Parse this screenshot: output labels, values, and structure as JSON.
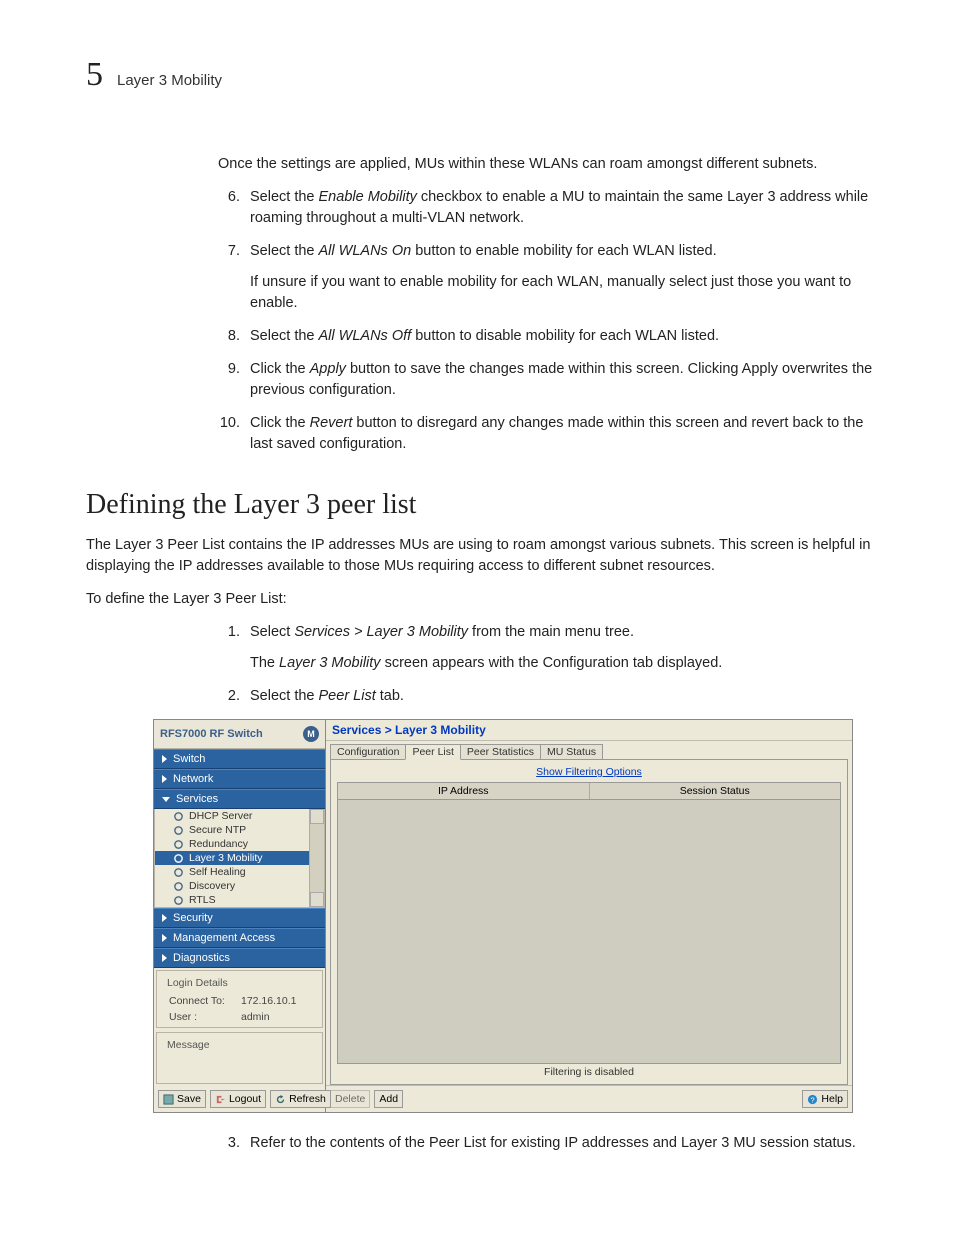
{
  "header": {
    "chapter": "5",
    "title": "Layer 3 Mobility"
  },
  "intro": "Once the settings are applied, MUs within these WLANs can roam amongst different subnets.",
  "steps_a": [
    {
      "n": "6.",
      "text": "Select the Enable Mobility checkbox to enable a MU to maintain the same Layer 3 address while roaming throughout a multi-VLAN network.",
      "italic": "Enable Mobility"
    },
    {
      "n": "7.",
      "text": "Select the All WLANs On button to enable mobility for each WLAN listed.",
      "italic": "All WLANs On",
      "sub": "If unsure if you want to enable mobility for each WLAN, manually select just those you want to enable."
    },
    {
      "n": "8.",
      "text": "Select the All WLANs Off button to disable mobility for each WLAN listed.",
      "italic": "All WLANs Off"
    },
    {
      "n": "9.",
      "text": "Click the Apply button to save the changes made within this screen. Clicking Apply overwrites the previous configuration.",
      "italic": "Apply"
    },
    {
      "n": "10.",
      "text": "Click the Revert button to disregard any changes made within this screen and revert back to the last saved configuration.",
      "italic": "Revert"
    }
  ],
  "section_title": "Defining the Layer 3 peer list",
  "section_p1": "The Layer 3 Peer List contains the IP addresses MUs are using to roam amongst various subnets. This screen is helpful in displaying the IP addresses available to those MUs requiring access to different subnet resources.",
  "section_p2": "To define the Layer 3 Peer List:",
  "steps_b": [
    {
      "n": "1.",
      "text": "Select Services > Layer 3 Mobility from the main menu tree.",
      "italic": "Services > Layer 3 Mobility",
      "sub": "The Layer 3 Mobility screen appears with the Configuration tab displayed.",
      "sub_italic": "Layer 3 Mobility"
    },
    {
      "n": "2.",
      "text": "Select the Peer List tab.",
      "italic": "Peer List"
    }
  ],
  "step_after": {
    "n": "3.",
    "text": "Refer to the contents of the Peer List for existing IP addresses and Layer 3 MU session status."
  },
  "screenshot": {
    "brand_label": "RFS7000 RF Switch",
    "brand_bold": "7000",
    "nav": {
      "switch": "Switch",
      "network": "Network",
      "services": "Services",
      "items": [
        "DHCP Server",
        "Secure NTP",
        "Redundancy",
        "Layer 3 Mobility",
        "Self Healing",
        "Discovery",
        "RTLS"
      ],
      "selected_index": 3,
      "security": "Security",
      "mgmt": "Management Access",
      "diag": "Diagnostics"
    },
    "login_panel": {
      "title": "Login Details",
      "connect_lbl": "Connect To:",
      "connect_val": "172.16.10.1",
      "user_lbl": "User :",
      "user_val": "admin"
    },
    "message_panel": {
      "title": "Message"
    },
    "side_buttons": {
      "save": "Save",
      "logout": "Logout",
      "refresh": "Refresh"
    },
    "crumb": "Services > Layer 3 Mobility",
    "tabs": [
      "Configuration",
      "Peer List",
      "Peer Statistics",
      "MU Status"
    ],
    "active_tab": 1,
    "filter_link": "Show Filtering Options",
    "columns": [
      "IP Address",
      "Session Status"
    ],
    "filter_note": "Filtering is disabled",
    "footer": {
      "delete": "Delete",
      "add": "Add",
      "help": "Help"
    }
  }
}
